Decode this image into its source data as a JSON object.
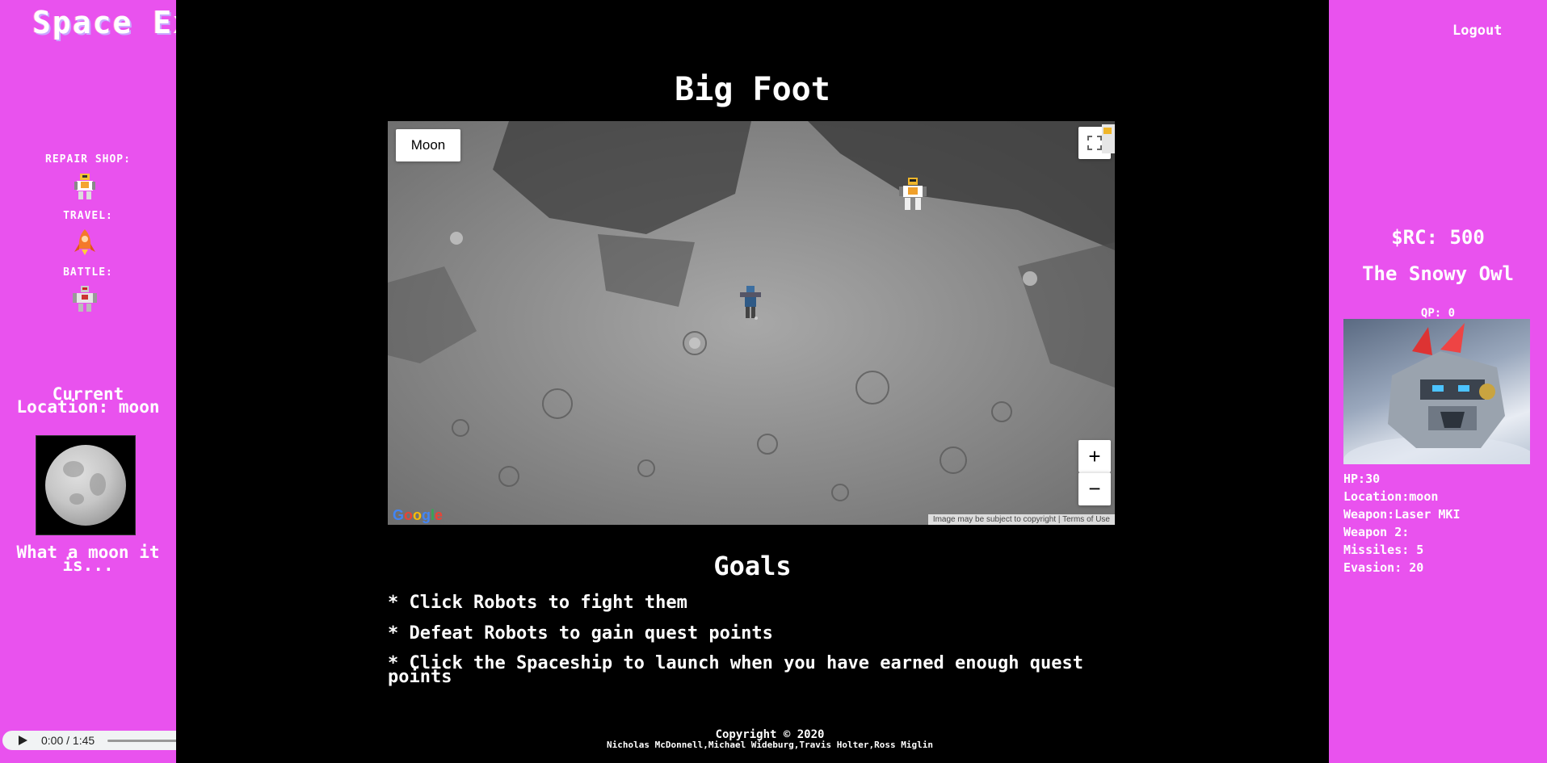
{
  "brand": {
    "title": "Space Explorers"
  },
  "nav": {
    "items": [
      {
        "label": "REPAIR SHOP:",
        "icon": "repair-robot-icon"
      },
      {
        "label": "TRAVEL:",
        "icon": "rocket-icon"
      },
      {
        "label": "BATTLE:",
        "icon": "battle-robot-icon"
      }
    ]
  },
  "location": {
    "title": "Current Location: moon",
    "description": "What a moon it is..."
  },
  "audio": {
    "time": "0:00 / 1:45"
  },
  "header": {
    "logout": "Logout"
  },
  "main": {
    "quest_title": "Big Foot",
    "map": {
      "type_label": "Moon",
      "zoom_in": "+",
      "zoom_out": "−",
      "google": "Google",
      "attribution": "Image may be subject to copyright   |   Terms of Use"
    },
    "goals_title": "Goals",
    "goals": [
      "* Click Robots to fight them",
      "* Defeat Robots to gain quest points",
      "* Click the Spaceship to launch when you have earned enough quest points"
    ]
  },
  "player": {
    "rc": "$RC: 500",
    "robot_name": "The Snowy Owl",
    "qp": "QP: 0",
    "stats": [
      "HP:30",
      "Location:moon",
      "Weapon:Laser MKI",
      "Weapon 2:",
      "Missiles: 5",
      "Evasion: 20"
    ]
  },
  "footer": {
    "copyright": "Copyright © 2020",
    "authors": "Nicholas McDonnell,Michael Wideburg,Travis Holter,Ross Miglin"
  },
  "colors": {
    "panel": "#e952ee",
    "background": "#000000"
  }
}
